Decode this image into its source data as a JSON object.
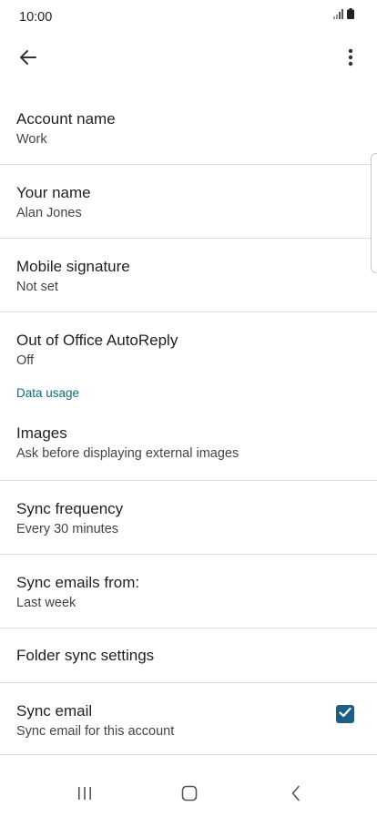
{
  "status_bar": {
    "time": "10:00",
    "icons": [
      "signal-icon",
      "battery-icon"
    ]
  },
  "app_bar": {
    "back_icon": "arrow-left-icon",
    "menu_icon": "more-vert-icon"
  },
  "rows": [
    {
      "title": "Account name",
      "subtitle": "Work"
    },
    {
      "title": "Your name",
      "subtitle": "Alan Jones"
    },
    {
      "title": "Mobile signature",
      "subtitle": "Not set"
    },
    {
      "title": "Out of Office AutoReply",
      "subtitle": "Off"
    }
  ],
  "data_usage": {
    "header": "Data usage",
    "images": {
      "title": "Images",
      "subtitle": "Ask before displaying external images"
    },
    "sync_frequency": {
      "title": "Sync frequency",
      "subtitle": "Every 30 minutes"
    },
    "sync_emails_from": {
      "title": "Sync emails from:",
      "subtitle": "Last week"
    },
    "folder_sync": {
      "title": "Folder sync settings"
    },
    "sync_email": {
      "title": "Sync email",
      "subtitle": "Sync email for this account",
      "checked": true
    }
  },
  "colors": {
    "accent": "#0d6d7e",
    "checkbox": "#1d5e82",
    "divider": "#dcdcdc"
  },
  "nav_bar": {
    "icons": [
      "recent-apps-icon",
      "home-icon",
      "back-icon"
    ]
  }
}
